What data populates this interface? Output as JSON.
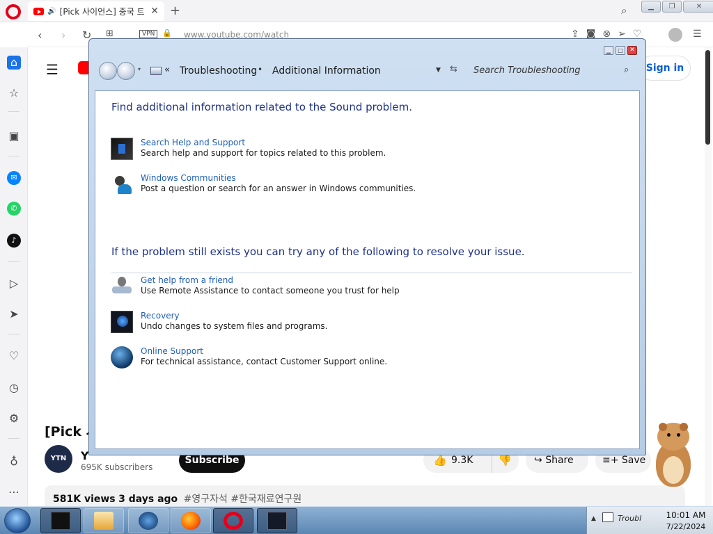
{
  "browser": {
    "tab_title": "[Pick 사이언스] 중국 트",
    "url": "www.youtube.com/watch",
    "vpn_label": "VPN"
  },
  "youtube": {
    "signin_label": "Sign in",
    "video_title": "[Pick 사",
    "channel_name": "YTN 사이언스",
    "channel_avatar_text": "YTN",
    "subscribers": "695K subscribers",
    "subscribe_label": "Subscribe",
    "likes": "9.3K",
    "share_label": "Share",
    "save_label": "Save",
    "views": "581K views",
    "time_ago": "3 days ago",
    "hashtags": "#영구자석 #한국재료연구원"
  },
  "troubleshooter": {
    "breadcrumb_root": "Troubleshooting",
    "breadcrumb_current": "Additional Information",
    "search_placeholder": "Search Troubleshooting",
    "heading_1": "Find additional information related to the Sound problem.",
    "heading_2": "If the problem still exists you can try any of the following to resolve your issue.",
    "items": [
      {
        "link": "Search Help and Support",
        "desc": "Search help and support for topics related to this problem.",
        "icon": "help-support-icon"
      },
      {
        "link": "Windows Communities",
        "desc": "Post a question or search for an answer in Windows communities.",
        "icon": "communities-icon"
      },
      {
        "link": "Get help from a friend",
        "desc": "Use Remote Assistance to contact someone you trust for help",
        "icon": "remote-assistance-icon"
      },
      {
        "link": "Recovery",
        "desc": "Undo changes to system files and programs.",
        "icon": "recovery-icon"
      },
      {
        "link": "Online Support",
        "desc": "For technical assistance, contact Customer Support online.",
        "icon": "online-support-icon"
      }
    ]
  },
  "taskbar": {
    "tray_label": "Troubl",
    "time": "10:01 AM",
    "date": "7/22/2024"
  },
  "colors": {
    "link": "#1f5fb8",
    "heading": "#1e3287",
    "youtube_red": "#ff0000",
    "opera_red": "#e3001b"
  }
}
